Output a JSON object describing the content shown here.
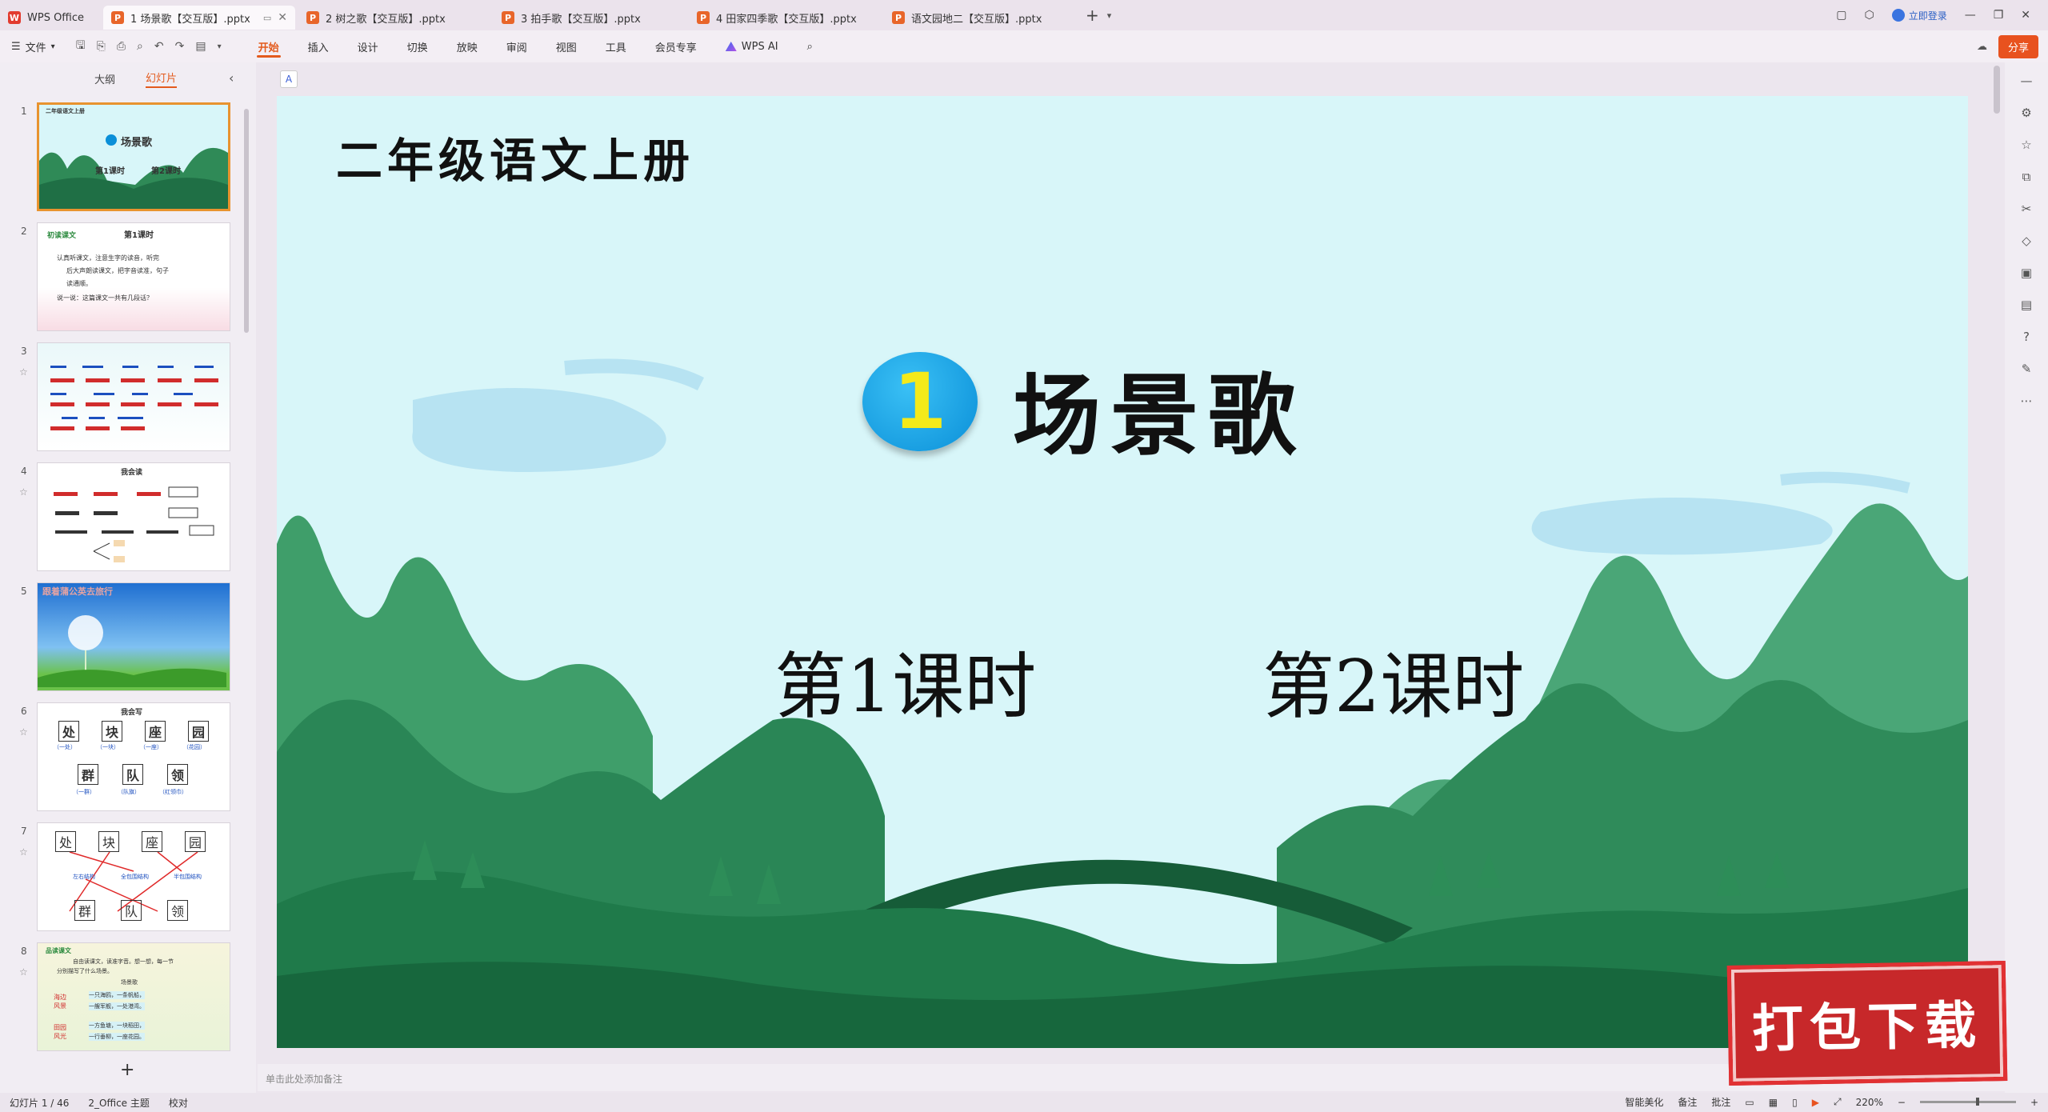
{
  "tabs": [
    {
      "label": "WPS Office",
      "type": "home"
    },
    {
      "label": "1 场景歌【交互版】.pptx",
      "active": true
    },
    {
      "label": "2 树之歌【交互版】.pptx"
    },
    {
      "label": "3 拍手歌【交互版】.pptx"
    },
    {
      "label": "4 田家四季歌【交互版】.pptx"
    },
    {
      "label": "语文园地二【交互版】.pptx"
    }
  ],
  "titlebar": {
    "login": "立即登录"
  },
  "ribbon": {
    "file": "文件",
    "tabs": [
      "开始",
      "插入",
      "设计",
      "切换",
      "放映",
      "审阅",
      "视图",
      "工具",
      "会员专享"
    ],
    "ai": "WPS AI",
    "share": "分享"
  },
  "leftpanel": {
    "tab_outline": "大纲",
    "tab_slides": "幻灯片",
    "slides": [
      {
        "num": "1",
        "title": "场景歌",
        "sub1": "第1课时",
        "sub2": "第2课时",
        "header": "二年级语文上册"
      },
      {
        "num": "2",
        "title": "第1课时",
        "tag": "初读课文",
        "lines": [
          "认真听课文，注意生字的读音，听完",
          "后大声朗读课文，把字音读准，句子",
          "读通顺。",
          "说一说：这篇课文一共有几段话？"
        ]
      },
      {
        "num": "3"
      },
      {
        "num": "4",
        "title": "我会读"
      },
      {
        "num": "5",
        "title": "跟着蒲公英去旅行"
      },
      {
        "num": "6",
        "title": "我会写",
        "chars": [
          "处",
          "块",
          "座",
          "园",
          "群",
          "队",
          "领"
        ],
        "words": [
          "（一处）",
          "（一块）",
          "（一座）",
          "（花园）",
          "（一群）",
          "（队旗）",
          "（红领巾）"
        ]
      },
      {
        "num": "7",
        "chars": [
          "处",
          "块",
          "座",
          "园",
          "群",
          "队",
          "领"
        ],
        "labels": [
          "左右结构",
          "全包围结构",
          "半包围结构"
        ]
      },
      {
        "num": "8",
        "tag": "品读课文",
        "lines": [
          "自由读课文，读准字音。想一想，每一节",
          "分别描写了什么场景。",
          "场景歌",
          "一只海鸥，一条帆船，",
          "一艘军舰，一处港湾。",
          "一方鱼塘，一块稻田，",
          "一行垂柳，一座花园。"
        ],
        "side": [
          "海边风景",
          "田园风光"
        ]
      }
    ]
  },
  "slide": {
    "grade": "二年级语文上册",
    "number": "1",
    "title": "场景歌",
    "period1": "第1课时",
    "period2": "第2课时",
    "colors": {
      "sky": "#d8f6f9",
      "mountain_dark": "#1f7a4a",
      "mountain_light": "#3fa06a",
      "circle": "#0a8fd8",
      "digit": "#f4ea1a"
    }
  },
  "notes_placeholder": "单击此处添加备注",
  "statusbar": {
    "slide_count": "幻灯片 1 / 46",
    "theme": "2_Office 主题",
    "proof": "校对",
    "beautify": "智能美化",
    "notes": "备注",
    "comments": "批注",
    "zoom": "220%"
  },
  "stamp": "打包下载"
}
